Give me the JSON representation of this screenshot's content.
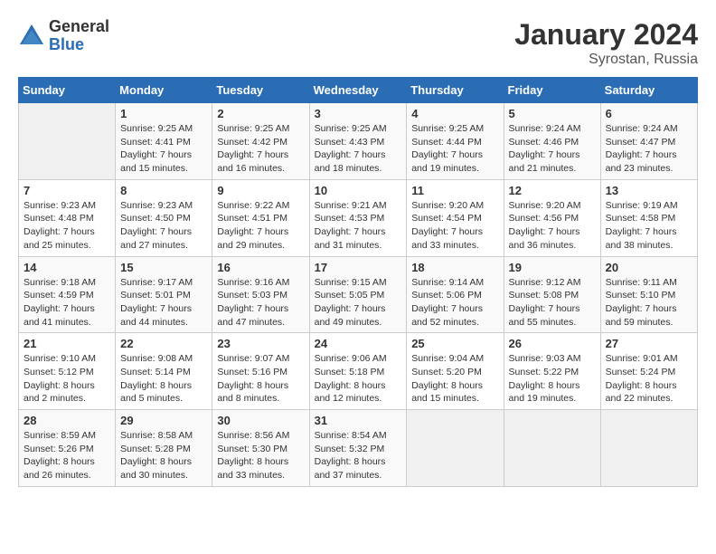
{
  "logo": {
    "general": "General",
    "blue": "Blue"
  },
  "title": "January 2024",
  "subtitle": "Syrostan, Russia",
  "weekdays": [
    "Sunday",
    "Monday",
    "Tuesday",
    "Wednesday",
    "Thursday",
    "Friday",
    "Saturday"
  ],
  "weeks": [
    [
      {
        "day": "",
        "sunrise": "",
        "sunset": "",
        "daylight": ""
      },
      {
        "day": "1",
        "sunrise": "Sunrise: 9:25 AM",
        "sunset": "Sunset: 4:41 PM",
        "daylight": "Daylight: 7 hours and 15 minutes."
      },
      {
        "day": "2",
        "sunrise": "Sunrise: 9:25 AM",
        "sunset": "Sunset: 4:42 PM",
        "daylight": "Daylight: 7 hours and 16 minutes."
      },
      {
        "day": "3",
        "sunrise": "Sunrise: 9:25 AM",
        "sunset": "Sunset: 4:43 PM",
        "daylight": "Daylight: 7 hours and 18 minutes."
      },
      {
        "day": "4",
        "sunrise": "Sunrise: 9:25 AM",
        "sunset": "Sunset: 4:44 PM",
        "daylight": "Daylight: 7 hours and 19 minutes."
      },
      {
        "day": "5",
        "sunrise": "Sunrise: 9:24 AM",
        "sunset": "Sunset: 4:46 PM",
        "daylight": "Daylight: 7 hours and 21 minutes."
      },
      {
        "day": "6",
        "sunrise": "Sunrise: 9:24 AM",
        "sunset": "Sunset: 4:47 PM",
        "daylight": "Daylight: 7 hours and 23 minutes."
      }
    ],
    [
      {
        "day": "7",
        "sunrise": "Sunrise: 9:23 AM",
        "sunset": "Sunset: 4:48 PM",
        "daylight": "Daylight: 7 hours and 25 minutes."
      },
      {
        "day": "8",
        "sunrise": "Sunrise: 9:23 AM",
        "sunset": "Sunset: 4:50 PM",
        "daylight": "Daylight: 7 hours and 27 minutes."
      },
      {
        "day": "9",
        "sunrise": "Sunrise: 9:22 AM",
        "sunset": "Sunset: 4:51 PM",
        "daylight": "Daylight: 7 hours and 29 minutes."
      },
      {
        "day": "10",
        "sunrise": "Sunrise: 9:21 AM",
        "sunset": "Sunset: 4:53 PM",
        "daylight": "Daylight: 7 hours and 31 minutes."
      },
      {
        "day": "11",
        "sunrise": "Sunrise: 9:20 AM",
        "sunset": "Sunset: 4:54 PM",
        "daylight": "Daylight: 7 hours and 33 minutes."
      },
      {
        "day": "12",
        "sunrise": "Sunrise: 9:20 AM",
        "sunset": "Sunset: 4:56 PM",
        "daylight": "Daylight: 7 hours and 36 minutes."
      },
      {
        "day": "13",
        "sunrise": "Sunrise: 9:19 AM",
        "sunset": "Sunset: 4:58 PM",
        "daylight": "Daylight: 7 hours and 38 minutes."
      }
    ],
    [
      {
        "day": "14",
        "sunrise": "Sunrise: 9:18 AM",
        "sunset": "Sunset: 4:59 PM",
        "daylight": "Daylight: 7 hours and 41 minutes."
      },
      {
        "day": "15",
        "sunrise": "Sunrise: 9:17 AM",
        "sunset": "Sunset: 5:01 PM",
        "daylight": "Daylight: 7 hours and 44 minutes."
      },
      {
        "day": "16",
        "sunrise": "Sunrise: 9:16 AM",
        "sunset": "Sunset: 5:03 PM",
        "daylight": "Daylight: 7 hours and 47 minutes."
      },
      {
        "day": "17",
        "sunrise": "Sunrise: 9:15 AM",
        "sunset": "Sunset: 5:05 PM",
        "daylight": "Daylight: 7 hours and 49 minutes."
      },
      {
        "day": "18",
        "sunrise": "Sunrise: 9:14 AM",
        "sunset": "Sunset: 5:06 PM",
        "daylight": "Daylight: 7 hours and 52 minutes."
      },
      {
        "day": "19",
        "sunrise": "Sunrise: 9:12 AM",
        "sunset": "Sunset: 5:08 PM",
        "daylight": "Daylight: 7 hours and 55 minutes."
      },
      {
        "day": "20",
        "sunrise": "Sunrise: 9:11 AM",
        "sunset": "Sunset: 5:10 PM",
        "daylight": "Daylight: 7 hours and 59 minutes."
      }
    ],
    [
      {
        "day": "21",
        "sunrise": "Sunrise: 9:10 AM",
        "sunset": "Sunset: 5:12 PM",
        "daylight": "Daylight: 8 hours and 2 minutes."
      },
      {
        "day": "22",
        "sunrise": "Sunrise: 9:08 AM",
        "sunset": "Sunset: 5:14 PM",
        "daylight": "Daylight: 8 hours and 5 minutes."
      },
      {
        "day": "23",
        "sunrise": "Sunrise: 9:07 AM",
        "sunset": "Sunset: 5:16 PM",
        "daylight": "Daylight: 8 hours and 8 minutes."
      },
      {
        "day": "24",
        "sunrise": "Sunrise: 9:06 AM",
        "sunset": "Sunset: 5:18 PM",
        "daylight": "Daylight: 8 hours and 12 minutes."
      },
      {
        "day": "25",
        "sunrise": "Sunrise: 9:04 AM",
        "sunset": "Sunset: 5:20 PM",
        "daylight": "Daylight: 8 hours and 15 minutes."
      },
      {
        "day": "26",
        "sunrise": "Sunrise: 9:03 AM",
        "sunset": "Sunset: 5:22 PM",
        "daylight": "Daylight: 8 hours and 19 minutes."
      },
      {
        "day": "27",
        "sunrise": "Sunrise: 9:01 AM",
        "sunset": "Sunset: 5:24 PM",
        "daylight": "Daylight: 8 hours and 22 minutes."
      }
    ],
    [
      {
        "day": "28",
        "sunrise": "Sunrise: 8:59 AM",
        "sunset": "Sunset: 5:26 PM",
        "daylight": "Daylight: 8 hours and 26 minutes."
      },
      {
        "day": "29",
        "sunrise": "Sunrise: 8:58 AM",
        "sunset": "Sunset: 5:28 PM",
        "daylight": "Daylight: 8 hours and 30 minutes."
      },
      {
        "day": "30",
        "sunrise": "Sunrise: 8:56 AM",
        "sunset": "Sunset: 5:30 PM",
        "daylight": "Daylight: 8 hours and 33 minutes."
      },
      {
        "day": "31",
        "sunrise": "Sunrise: 8:54 AM",
        "sunset": "Sunset: 5:32 PM",
        "daylight": "Daylight: 8 hours and 37 minutes."
      },
      {
        "day": "",
        "sunrise": "",
        "sunset": "",
        "daylight": ""
      },
      {
        "day": "",
        "sunrise": "",
        "sunset": "",
        "daylight": ""
      },
      {
        "day": "",
        "sunrise": "",
        "sunset": "",
        "daylight": ""
      }
    ]
  ]
}
